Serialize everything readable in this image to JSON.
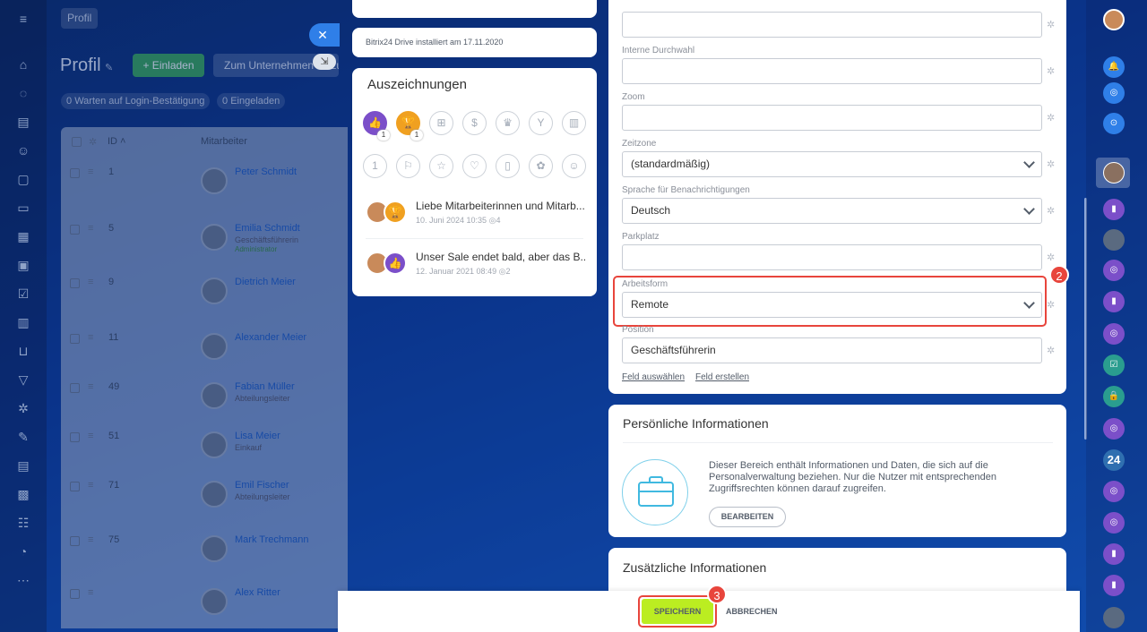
{
  "app": {
    "breadcrumb": "Profil",
    "page_title": "Profil",
    "invite_label": "+ Einladen",
    "company_label": "Zum Unternehmen hinzufügen"
  },
  "filters": [
    {
      "count": "0",
      "label": "Warten auf Login-Bestätigung"
    },
    {
      "count": "0",
      "label": "Eingeladen"
    }
  ],
  "table": {
    "header": {
      "id": "ID",
      "employee": "Mitarbeiter"
    },
    "rows": [
      {
        "id": "1",
        "name": "Peter Schmidt",
        "position": "",
        "role": ""
      },
      {
        "id": "5",
        "name": "Emilia Schmidt",
        "position": "Geschäftsführerin",
        "role": "Administrator"
      },
      {
        "id": "9",
        "name": "Dietrich Meier",
        "position": "",
        "role": ""
      },
      {
        "id": "11",
        "name": "Alexander Meier",
        "position": "",
        "role": ""
      },
      {
        "id": "49",
        "name": "Fabian Müller",
        "position": "Abteilungsleiter",
        "role": ""
      },
      {
        "id": "51",
        "name": "Lisa Meier",
        "position": "Einkauf",
        "role": ""
      },
      {
        "id": "71",
        "name": "Emil Fischer",
        "position": "Abteilungsleiter",
        "role": ""
      },
      {
        "id": "75",
        "name": "Mark Trechmann",
        "position": "",
        "role": ""
      },
      {
        "id": "",
        "name": "Alex Ritter",
        "position": "",
        "role": ""
      }
    ]
  },
  "left": {
    "drive_text": "Bitrix24 Drive installiert am 17.11.2020",
    "awards_title": "Auszeichnungen",
    "badge_counts": [
      "1",
      "1"
    ],
    "posts": [
      {
        "title": "Liebe Mitarbeiterinnen und Mitarb...",
        "meta": "10. Juni 2024 10:35",
        "views": "4"
      },
      {
        "title": "Unser Sale endet bald, aber das B...",
        "meta": "12. Januar 2021 08:49",
        "views": "2"
      }
    ]
  },
  "fields": {
    "internal_label": "Interne Durchwahl",
    "zoom_label": "Zoom",
    "timezone_label": "Zeitzone",
    "timezone_value": "(standardmäßig)",
    "language_label": "Sprache für Benachrichtigungen",
    "language_value": "Deutsch",
    "parking_label": "Parkplatz",
    "workform_label": "Arbeitsform",
    "workform_value": "Remote",
    "position_label": "Position",
    "position_value": "Geschäftsführerin",
    "select_field": "Feld auswählen",
    "create_field": "Feld erstellen"
  },
  "personal": {
    "title": "Persönliche Informationen",
    "text": "Dieser Bereich enthält Informationen und Daten, die sich auf die Personalverwaltung beziehen. Nur die Nutzer mit entsprechenden Zugriffsrechten können darauf zugreifen.",
    "button": "BEARBEITEN"
  },
  "additional": {
    "title": "Zusätzliche Informationen"
  },
  "footer": {
    "save": "SPEICHERN",
    "cancel": "ABBRECHEN"
  },
  "steps": [
    "2",
    "3"
  ],
  "right": {
    "badge_24": "24"
  },
  "colors": {
    "accent": "#bbed21",
    "marker": "#e8453c",
    "link": "#2067b0"
  }
}
